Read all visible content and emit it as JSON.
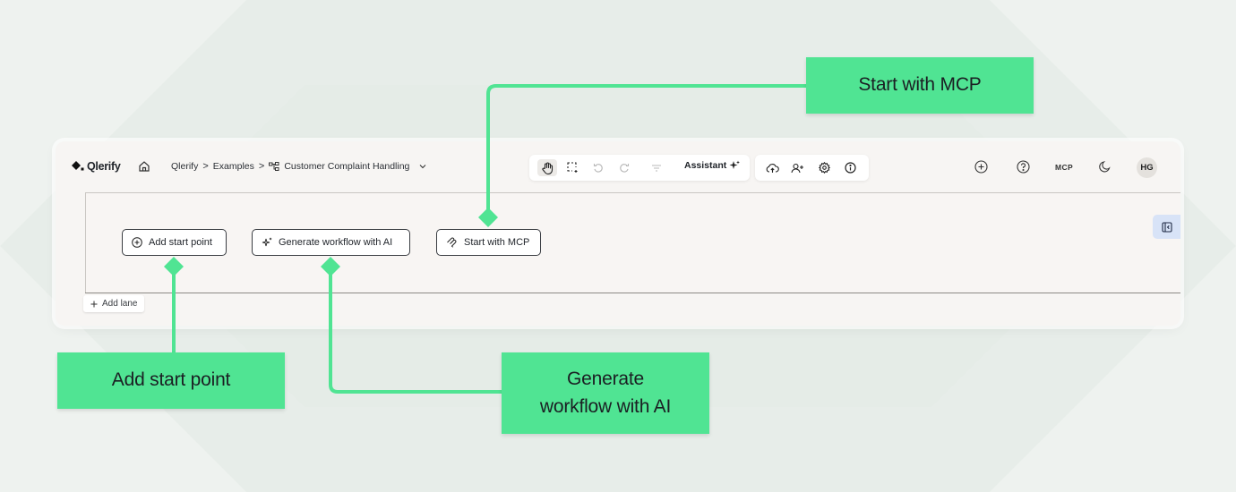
{
  "app": {
    "logo_text": "Qlerify",
    "breadcrumb": [
      "Qlerify",
      "Examples",
      "Customer Complaint Handling"
    ],
    "breadcrumb_sep": ">",
    "assistant_label": "Assistant",
    "mcp_label": "MCP",
    "avatar_initials": "HG"
  },
  "canvas": {
    "actions": [
      {
        "label": "Add start point",
        "icon": "plus-circle-icon"
      },
      {
        "label": "Generate workflow with AI",
        "icon": "sparkle-icon"
      },
      {
        "label": "Start with MCP",
        "icon": "mcp-icon"
      }
    ],
    "add_lane_label": "Add lane"
  },
  "callouts": {
    "start_with_mcp": "Start with MCP",
    "add_start_point": "Add start point",
    "generate_line1": "Generate",
    "generate_line2": "workflow with AI"
  },
  "colors": {
    "callout": "#50e493",
    "background": "#eef2ef",
    "app_bg": "#f7f5f3",
    "panel_toggle": "#d8e3f7"
  }
}
